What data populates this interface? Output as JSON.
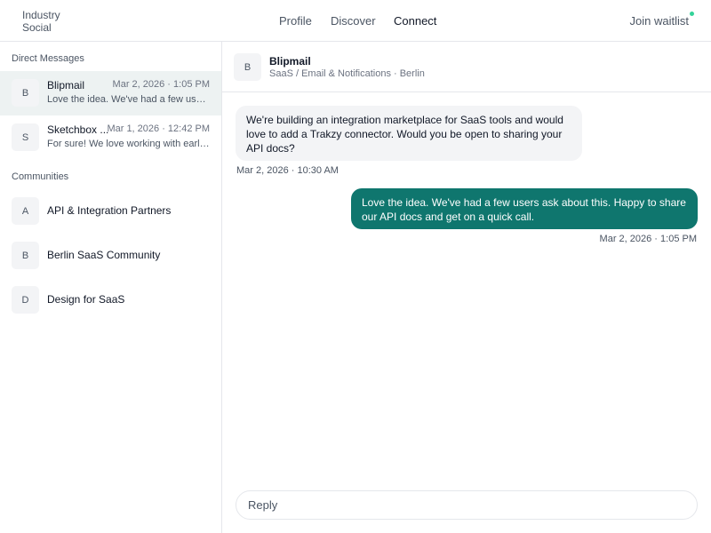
{
  "header": {
    "brand_line1": "Industry",
    "brand_line2": "Social",
    "nav": [
      {
        "label": "Profile",
        "active": false
      },
      {
        "label": "Discover",
        "active": false
      },
      {
        "label": "Connect",
        "active": true
      }
    ],
    "join_label": "Join waitlist"
  },
  "sidebar": {
    "dm_title": "Direct Messages",
    "dms": [
      {
        "initial": "B",
        "name": "Blipmail",
        "time": "Mar 2, 2026 · 1:05 PM",
        "preview": "Love the idea. We've had a few users ask about this.",
        "selected": true
      },
      {
        "initial": "S",
        "name": "Sketchbox ...",
        "time": "Mar 1, 2026 · 12:42 PM",
        "preview": "For sure! We love working with early-stage teams.",
        "selected": false
      }
    ],
    "communities_title": "Communities",
    "communities": [
      {
        "initial": "A",
        "name": "API & Integration Partners"
      },
      {
        "initial": "B",
        "name": "Berlin SaaS Community"
      },
      {
        "initial": "D",
        "name": "Design for SaaS"
      }
    ]
  },
  "thread": {
    "initial": "B",
    "name": "Blipmail",
    "subtitle": "SaaS / Email & Notifications · Berlin",
    "messages": [
      {
        "direction": "in",
        "text": "We're building an integration marketplace for SaaS tools and would love to add a Trakzy connector. Would you be open to sharing your API docs?",
        "time": "Mar 2, 2026 · 10:30 AM"
      },
      {
        "direction": "out",
        "text": "Love the idea. We've had a few users ask about this. Happy to share our API docs and get on a quick call.",
        "time": "Mar 2, 2026 · 1:05 PM"
      }
    ],
    "reply_placeholder": "Reply"
  },
  "colors": {
    "accent": "#0f766e",
    "selected_row": "#edf2f2",
    "status_dot": "#34d399"
  }
}
